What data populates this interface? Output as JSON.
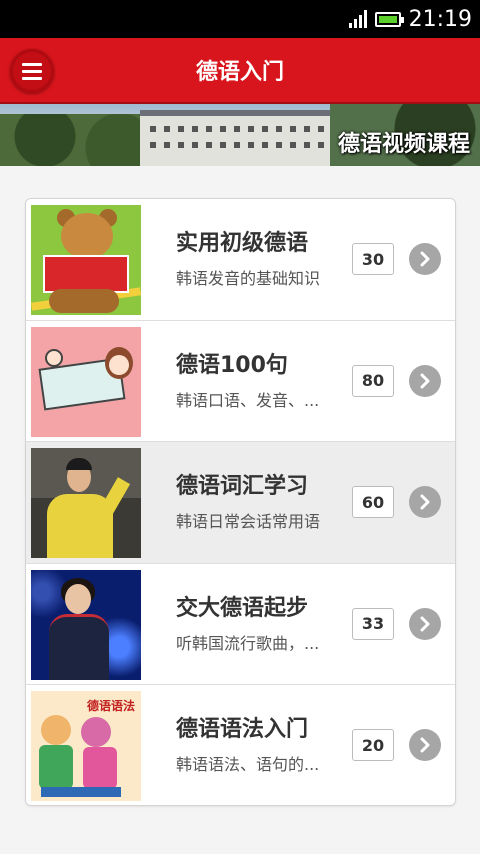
{
  "status_bar": {
    "time": "21:19",
    "signal_icon": "signal-bars-icon",
    "battery_icon": "battery-icon",
    "battery_level": 1.0,
    "battery_color": "#5dcf2c"
  },
  "app_bar": {
    "title": "德语入门",
    "menu_icon": "hamburger-menu-icon",
    "background": "#d8151c"
  },
  "banner": {
    "caption": "德语视频课程"
  },
  "courses": [
    {
      "title": "实用初级德语",
      "description": "韩语发音的基础知识",
      "count": "30",
      "thumbnail": "teddy-bear-reading"
    },
    {
      "title": "德语100句",
      "description": "韩语口语、发音、...",
      "count": "80",
      "thumbnail": "cartoon-card"
    },
    {
      "title": "德语词汇学习",
      "description": "韩语日常会话常用语",
      "count": "60",
      "thumbnail": "teacher-speaking"
    },
    {
      "title": "交大德语起步",
      "description": "听韩国流行歌曲，...",
      "count": "33",
      "thumbnail": "singer-on-stage"
    },
    {
      "title": "德语语法入门",
      "description": "韩语语法、语句的...",
      "count": "20",
      "thumbnail": "cartoon-dancers",
      "thumbnail_label": "德语语法"
    }
  ]
}
